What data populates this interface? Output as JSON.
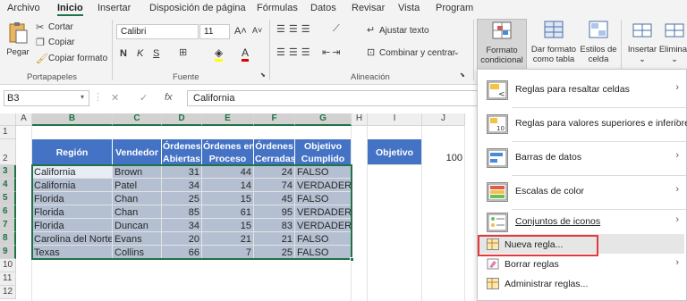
{
  "menu": {
    "tabs": [
      "Archivo",
      "Inicio",
      "Insertar",
      "Disposición de página",
      "Fórmulas",
      "Datos",
      "Revisar",
      "Vista",
      "Program"
    ],
    "active": "Inicio"
  },
  "ribbon": {
    "clipboard": {
      "paste": "Pegar",
      "cut": "Cortar",
      "copy": "Copiar",
      "format_painter": "Copiar formato",
      "group": "Portapapeles"
    },
    "font": {
      "name": "Calibri",
      "size": "11",
      "bold": "N",
      "italic": "K",
      "underline": "S",
      "group": "Fuente",
      "grow": "A˄",
      "shrink": "A˅",
      "font_color": "A",
      "fill": "◈"
    },
    "alignment": {
      "wrap": "Ajustar texto",
      "merge": "Combinar y centrar",
      "group": "Alineación"
    },
    "styles": {
      "conditional_1": "Formato",
      "conditional_2": "condicional",
      "table_1": "Dar formato",
      "table_2": "como tabla",
      "cell_1": "Estilos de",
      "cell_2": "celda"
    },
    "cells": {
      "insert": "Insertar",
      "delete": "Eliminar"
    }
  },
  "formula_bar": {
    "name_box": "B3",
    "value": "California",
    "fx": "fx"
  },
  "grid": {
    "columns": [
      "A",
      "B",
      "C",
      "D",
      "E",
      "F",
      "G",
      "H",
      "I",
      "J"
    ],
    "rows": [
      "1",
      "2",
      "3",
      "4",
      "5",
      "6",
      "7",
      "8",
      "9",
      "10",
      "11",
      "12"
    ],
    "headers": {
      "region": "Región",
      "seller": "Vendedor",
      "open_1": "Órdenes",
      "open_2": "Abiertas",
      "process_1": "Órdenes en",
      "process_2": "Proceso",
      "closed_1": "Órdenes",
      "closed_2": "Cerradas",
      "goal_1": "Objetivo",
      "goal_2": "Cumplido"
    },
    "objective_label": "Objetivo",
    "objective_value": "100",
    "data": [
      [
        "California",
        "Brown",
        "31",
        "44",
        "24",
        "FALSO"
      ],
      [
        "California",
        "Patel",
        "34",
        "14",
        "74",
        "VERDADERO"
      ],
      [
        "Florida",
        "Chan",
        "25",
        "15",
        "45",
        "FALSO"
      ],
      [
        "Florida",
        "Chan",
        "85",
        "61",
        "95",
        "VERDADERO"
      ],
      [
        "Florida",
        "Duncan",
        "34",
        "15",
        "83",
        "VERDADERO"
      ],
      [
        "Carolina del Norte",
        "Evans",
        "20",
        "21",
        "21",
        "FALSO"
      ],
      [
        "Texas",
        "Collins",
        "66",
        "7",
        "25",
        "FALSO"
      ]
    ]
  },
  "dropdown": {
    "items": [
      {
        "label": "Reglas para resaltar celdas",
        "icon": "highlight-cells-icon"
      },
      {
        "label": "Reglas para valores superiores e inferiores",
        "icon": "top-bottom-icon"
      },
      {
        "label": "Barras de datos",
        "icon": "data-bars-icon"
      },
      {
        "label": "Escalas de color",
        "icon": "color-scales-icon"
      },
      {
        "label": "Conjuntos de iconos",
        "icon": "icon-sets-icon"
      }
    ],
    "new_rule": "Nueva regla...",
    "clear_rules": "Borrar reglas",
    "manage_rules": "Administrar reglas..."
  },
  "colors": {
    "header_blue": "#4472c4",
    "data_fill": "#b4c0d2",
    "excel_green": "#217346",
    "highlight_red": "#e23b3b"
  }
}
